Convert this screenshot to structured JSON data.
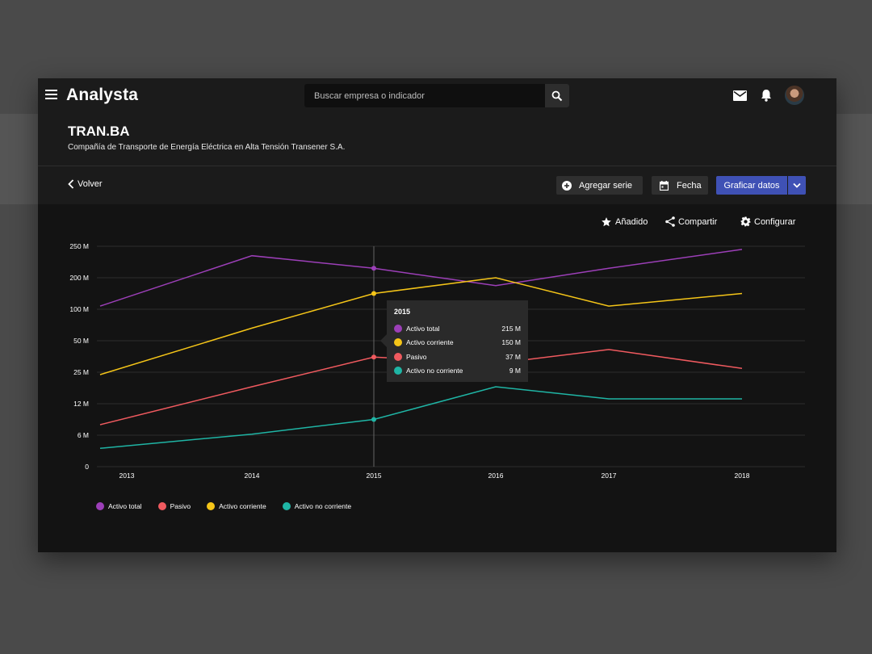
{
  "app": {
    "brand": "Analysta"
  },
  "search": {
    "placeholder": "Buscar empresa o indicador"
  },
  "company": {
    "ticker": "TRAN.BA",
    "name": "Compañía de Transporte de Energía Eléctrica en Alta Tensión Transener S.A."
  },
  "actions": {
    "back": "Volver",
    "add_series": "Agregar serie",
    "date": "Fecha",
    "plot": "Graficar datos"
  },
  "tools": {
    "added": "Añadido",
    "share": "Compartir",
    "configure": "Configurar"
  },
  "icons": [
    "menu-icon",
    "search-icon",
    "mail-icon",
    "bell-icon",
    "chevron-left-icon",
    "add-circle-icon",
    "calendar-icon",
    "chevron-down-icon",
    "star-icon",
    "share-icon",
    "gear-icon"
  ],
  "colors": {
    "Activo total": "#9c3fb8",
    "Activo corriente": "#f5c518",
    "Pasivo": "#f05a5f",
    "Activo no corriente": "#1fb5a5",
    "accent": "#3f51b5"
  },
  "tooltip": {
    "title": "2015",
    "rows": [
      {
        "label": "Activo total",
        "value": "215 M",
        "color": "#9c3fb8"
      },
      {
        "label": "Activo corriente",
        "value": "150 M",
        "color": "#f5c518"
      },
      {
        "label": "Pasivo",
        "value": "37 M",
        "color": "#f05a5f"
      },
      {
        "label": "Activo no corriente",
        "value": "9 M",
        "color": "#1fb5a5"
      }
    ]
  },
  "legend": [
    {
      "label": "Activo total",
      "color": "#9c3fb8"
    },
    {
      "label": "Pasivo",
      "color": "#f05a5f"
    },
    {
      "label": "Activo corriente",
      "color": "#f5c518"
    },
    {
      "label": "Activo no corriente",
      "color": "#1fb5a5"
    }
  ],
  "chart_data": {
    "type": "line",
    "x": [
      2013,
      2014,
      2015,
      2016,
      2017,
      2018
    ],
    "y_ticks": [
      "0",
      "6 M",
      "12 M",
      "25 M",
      "50 M",
      "100 M",
      "200 M",
      "250 M"
    ],
    "y_tick_values": [
      0,
      6,
      12,
      25,
      50,
      100,
      200,
      250
    ],
    "y_unit": "M",
    "highlight_x": 2015,
    "grid": true,
    "legend_position": "bottom-left",
    "series": [
      {
        "name": "Activo total",
        "color": "#9c3fb8",
        "x": [
          2012.8,
          2014,
          2015,
          2016,
          2017,
          2018
        ],
        "values": [
          110,
          235,
          215,
          175,
          215,
          245
        ]
      },
      {
        "name": "Activo corriente",
        "color": "#f5c518",
        "x": [
          2012.8,
          2014,
          2015,
          2016,
          2017,
          2018
        ],
        "values": [
          24,
          70,
          150,
          200,
          110,
          150
        ]
      },
      {
        "name": "Pasivo",
        "color": "#f05a5f",
        "x": [
          2012.8,
          2014,
          2015,
          2016,
          2017,
          2018
        ],
        "values": [
          8,
          19,
          37,
          32,
          43,
          28
        ]
      },
      {
        "name": "Activo no corriente",
        "color": "#1fb5a5",
        "x": [
          2012.8,
          2014,
          2015,
          2016,
          2017,
          2018
        ],
        "values": [
          3.5,
          6.2,
          9,
          19,
          14,
          14
        ]
      }
    ]
  }
}
